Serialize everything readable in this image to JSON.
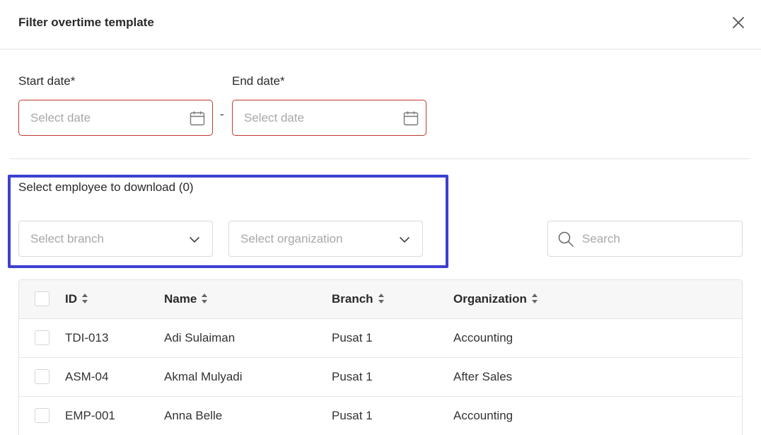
{
  "modal": {
    "title": "Filter overtime template"
  },
  "dates": {
    "start_label": "Start date*",
    "end_label": "End date*",
    "start_placeholder": "Select date",
    "end_placeholder": "Select date",
    "separator": "-"
  },
  "employee_select": {
    "label": "Select employee to download (0)",
    "branch_placeholder": "Select branch",
    "organization_placeholder": "Select organization"
  },
  "search": {
    "placeholder": "Search"
  },
  "table": {
    "columns": [
      "ID",
      "Name",
      "Branch",
      "Organization"
    ],
    "rows": [
      {
        "id": "TDI-013",
        "name": "Adi Sulaiman",
        "branch": "Pusat 1",
        "organization": "Accounting"
      },
      {
        "id": "ASM-04",
        "name": "Akmal Mulyadi",
        "branch": "Pusat 1",
        "organization": "After Sales"
      },
      {
        "id": "EMP-001",
        "name": "Anna Belle",
        "branch": "Pusat 1",
        "organization": "Accounting"
      }
    ]
  },
  "colors": {
    "error_border": "#c0392b",
    "highlight": "#3d3fd1",
    "header_bg": "#f7f7f7"
  }
}
